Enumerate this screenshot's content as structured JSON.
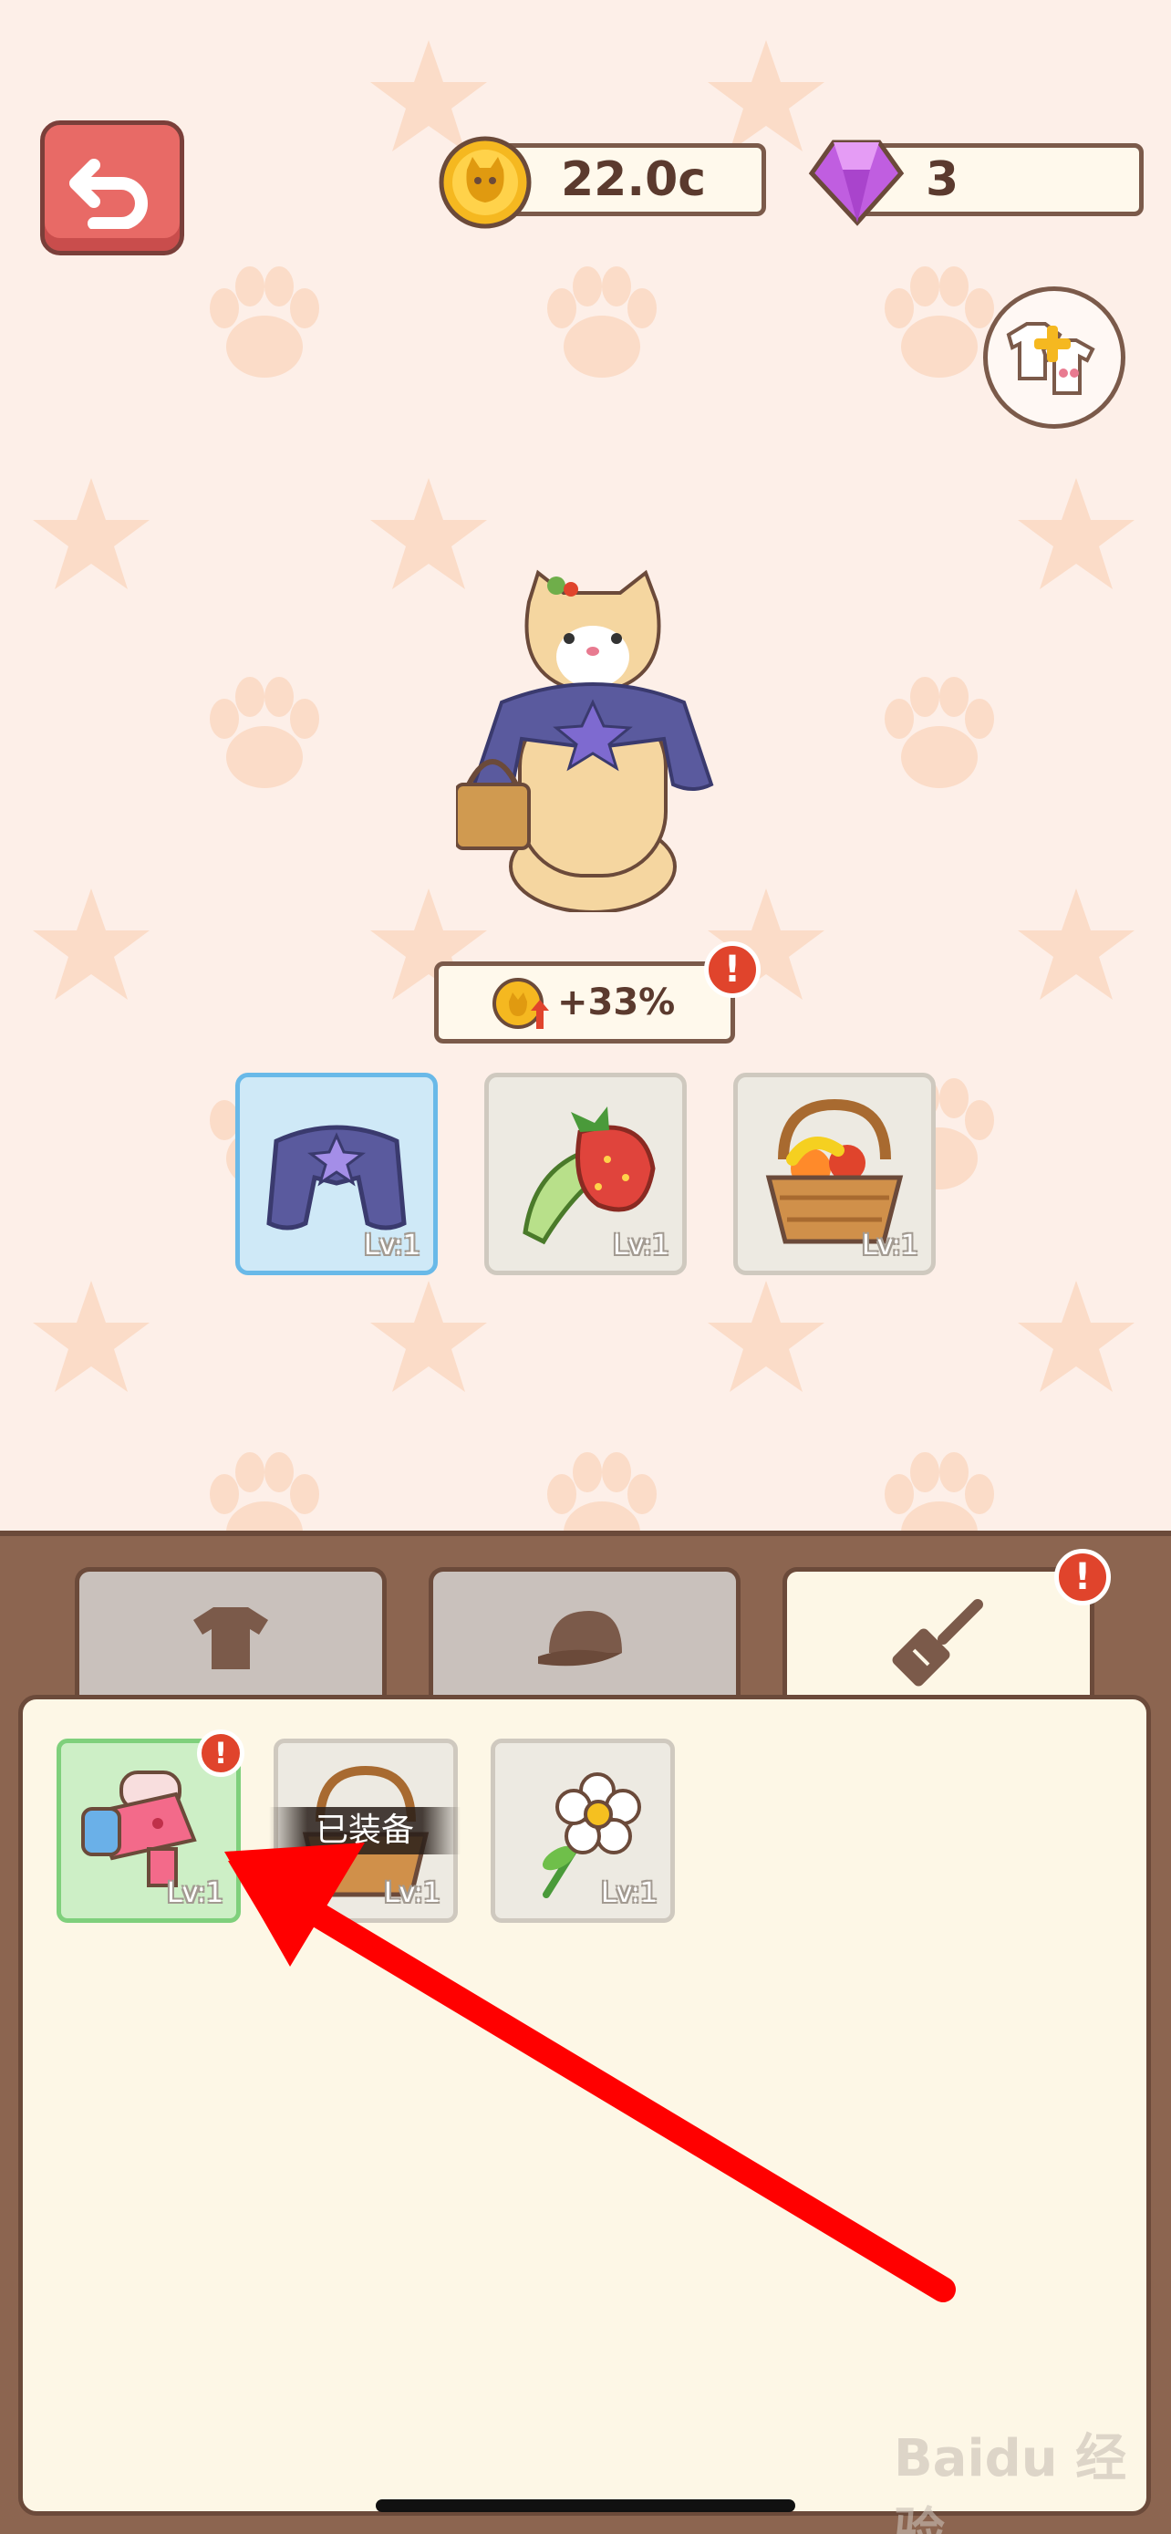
{
  "currency": {
    "coins": "22.0c",
    "gems": "3"
  },
  "bonus": {
    "value": "+33%",
    "alert": "!"
  },
  "equipped_slots": [
    {
      "name": "cape",
      "level": "Lv:1",
      "selected": true
    },
    {
      "name": "strawberry-leaf",
      "level": "Lv:1",
      "selected": false
    },
    {
      "name": "fruit-basket",
      "level": "Lv:1",
      "selected": false
    }
  ],
  "tabs": [
    {
      "name": "clothing",
      "icon": "shirt-icon"
    },
    {
      "name": "hats",
      "icon": "cap-icon"
    },
    {
      "name": "tools",
      "icon": "spatula-icon",
      "active": true,
      "alert": "!"
    }
  ],
  "inventory": {
    "items": [
      {
        "name": "paw-flashlight",
        "level": "Lv:1",
        "alert": "!",
        "selected": true
      },
      {
        "name": "fruit-basket",
        "level": "Lv:1",
        "status": "已装备"
      },
      {
        "name": "flower",
        "level": "Lv:1"
      }
    ]
  },
  "watermark": "Baidu 经验",
  "colors": {
    "background": "#fdefe8",
    "back_button": "#e86a66",
    "panel_frame": "#8c6550",
    "alert": "#e0442c",
    "selected_blue": "#69b9e8",
    "selected_green": "#7fd07c"
  }
}
